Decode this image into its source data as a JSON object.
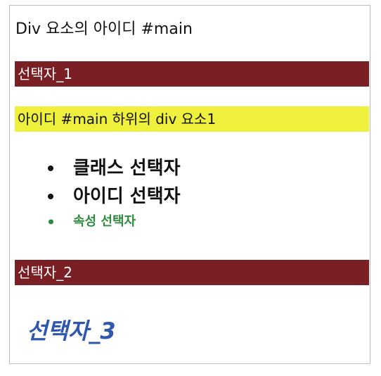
{
  "colors": {
    "frame_border": "#bdbdbd",
    "dark_red_bar": "#7a1f23",
    "yellow_bar": "#eef03b",
    "green_text": "#2e8b3d",
    "blue_text": "#2f57b0",
    "text_dark": "#111111"
  },
  "content": {
    "main_id_label": "Div 요소의 아이디 #main",
    "selector_1_label": "선택자_1",
    "descendant_label": "아이디 #main 하위의 div 요소1",
    "list_items": [
      "클래스 선택자",
      "아이디 선택자",
      "속성 선택자"
    ],
    "selector_2_label": "선택자_2",
    "selector_3_label": "선택자_3"
  },
  "icons": {
    "bullet": "filled-circle-icon"
  }
}
